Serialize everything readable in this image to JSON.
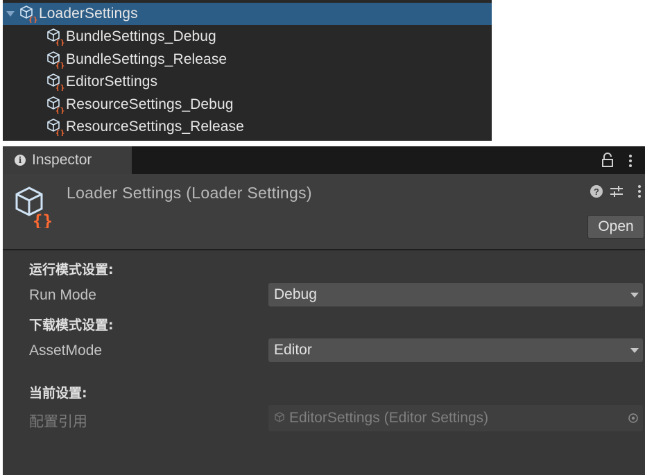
{
  "project_tree": {
    "selected_item": "LoaderSettings",
    "children": [
      "BundleSettings_Debug",
      "BundleSettings_Release",
      "EditorSettings",
      "ResourceSettings_Debug",
      "ResourceSettings_Release"
    ]
  },
  "inspector": {
    "tab_label": "Inspector",
    "title": "Loader Settings (Loader Settings)",
    "help_glyph": "?",
    "open_button": "Open",
    "sections": {
      "run_mode_header": "运行模式设置:",
      "download_mode_header": "下载模式设置:",
      "current_header": "当前设置:"
    },
    "fields": {
      "run_mode_label": "Run Mode",
      "run_mode_value": "Debug",
      "asset_mode_label": "AssetMode",
      "asset_mode_value": "Editor",
      "config_ref_label": "配置引用",
      "config_ref_value": "EditorSettings (Editor Settings)"
    }
  },
  "colors": {
    "selection": "#2c5d87",
    "panel_bg": "#282828",
    "inspector_bg": "#383838",
    "icon_accent": "#ff6a32",
    "icon_cube": "#cfe3f5"
  }
}
